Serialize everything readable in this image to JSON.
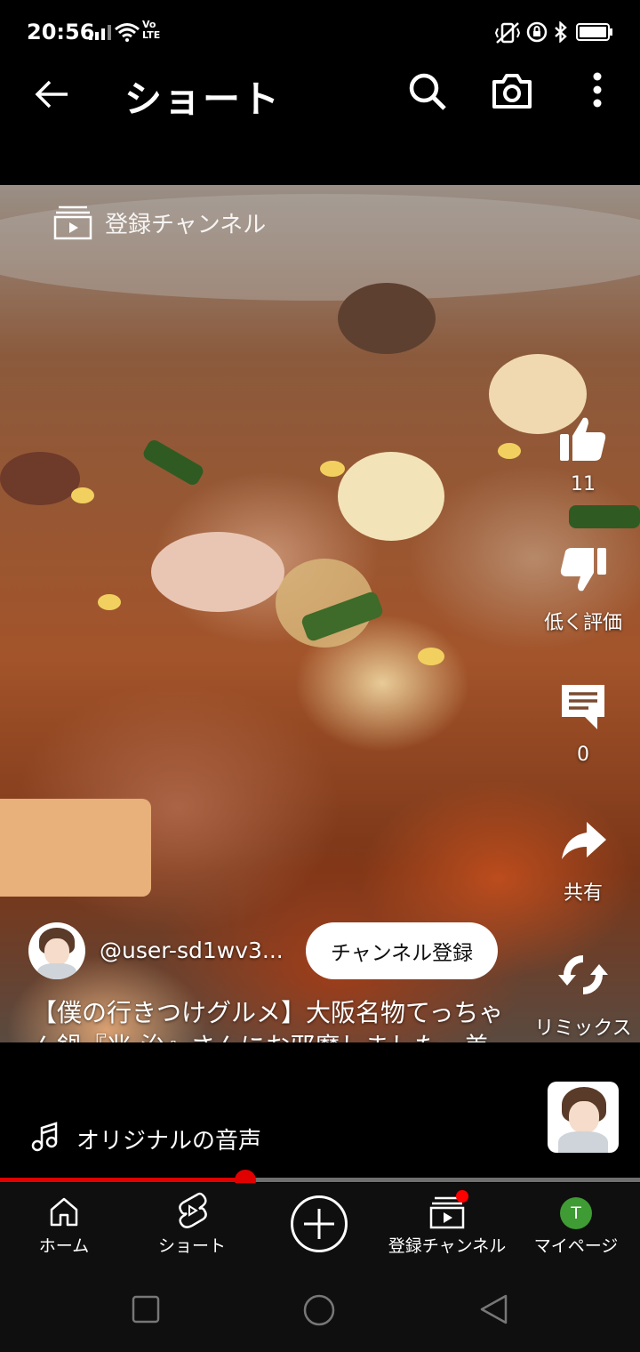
{
  "status_bar": {
    "time": "20:56",
    "volte": "Vo LTE"
  },
  "header": {
    "title": "ショート"
  },
  "video": {
    "subscriptions_label": "登録チャンネル"
  },
  "actions": {
    "like_count": "11",
    "dislike_label": "低く評価",
    "comment_count": "0",
    "share_label": "共有",
    "remix_label": "リミックス"
  },
  "channel": {
    "handle": "@user-sd1wv3...",
    "subscribe_label": "チャンネル登録"
  },
  "description": "【僕の行きつけグルメ】大阪名物てっちゃん鍋『兆-治』さんにお邪魔しました。美味しいお鍋に居心地…",
  "audio": {
    "label": "オリジナルの音声"
  },
  "progress": {
    "played_fraction": 0.384
  },
  "nav": {
    "home": "ホーム",
    "shorts": "ショート",
    "subscriptions": "登録チャンネル",
    "library": "マイページ",
    "avatar_letter": "T",
    "avatar_color": "#3f9b34",
    "badge_color": "#ff0000"
  }
}
